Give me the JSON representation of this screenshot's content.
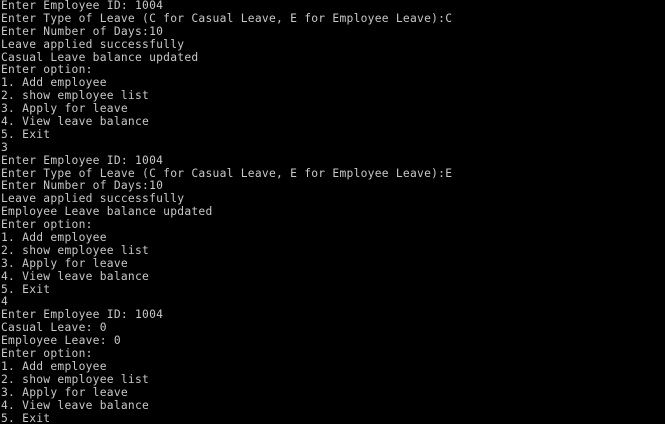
{
  "console": {
    "text_color": "#c8c8c8",
    "background_color": "#000000",
    "lines": [
      "Enter Employee ID: 1004",
      "Enter Type of Leave (C for Casual Leave, E for Employee Leave):C",
      "Enter Number of Days:10",
      "Leave applied successfully",
      "Casual Leave balance updated",
      "Enter option:",
      "1. Add employee",
      "2. show employee list",
      "3. Apply for leave",
      "4. View leave balance",
      "5. Exit",
      "3",
      "Enter Employee ID: 1004",
      "Enter Type of Leave (C for Casual Leave, E for Employee Leave):E",
      "Enter Number of Days:10",
      "Leave applied successfully",
      "Employee Leave balance updated",
      "Enter option:",
      "1. Add employee",
      "2. show employee list",
      "3. Apply for leave",
      "4. View leave balance",
      "5. Exit",
      "4",
      "Enter Employee ID: 1004",
      "Casual Leave: 0",
      "Employee Leave: 0",
      "Enter option:",
      "1. Add employee",
      "2. show employee list",
      "3. Apply for leave",
      "4. View leave balance",
      "5. Exit"
    ]
  }
}
